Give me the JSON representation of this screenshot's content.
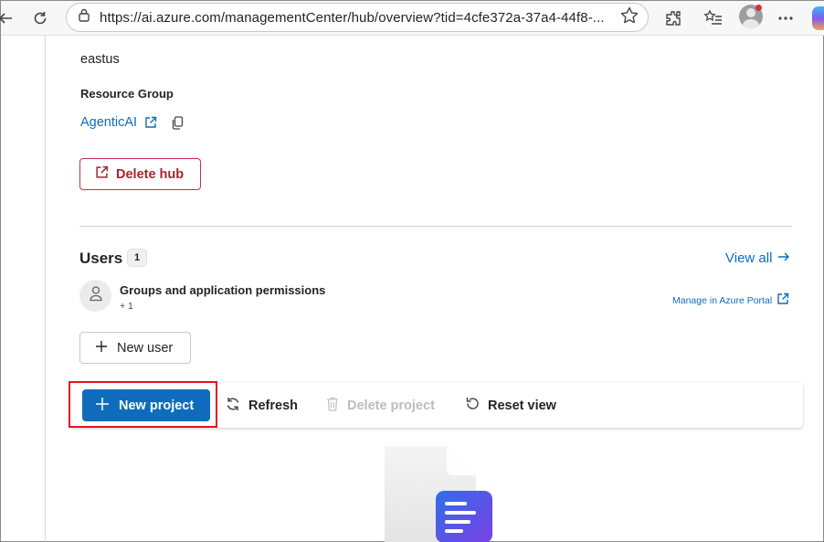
{
  "browser": {
    "url": "https://ai.azure.com/managementCenter/hub/overview?tid=4cfe372a-37a4-44f8-..."
  },
  "hub": {
    "location_value": "eastus",
    "resource_group_label": "Resource Group",
    "resource_group_link": "AgenticAI",
    "delete_label": "Delete hub"
  },
  "users": {
    "title": "Users",
    "count": "1",
    "view_all_label": "View all",
    "group_name": "Groups and application permissions",
    "group_sub": "+ 1",
    "manage_link": "Manage in Azure Portal",
    "new_user_label": "New user"
  },
  "commands": {
    "new_project_label": "New project",
    "refresh_label": "Refresh",
    "delete_project_label": "Delete project",
    "reset_view_label": "Reset view"
  },
  "colors": {
    "accent": "#0f6cbd",
    "danger": "#a4262c",
    "highlight": "#e81123"
  }
}
